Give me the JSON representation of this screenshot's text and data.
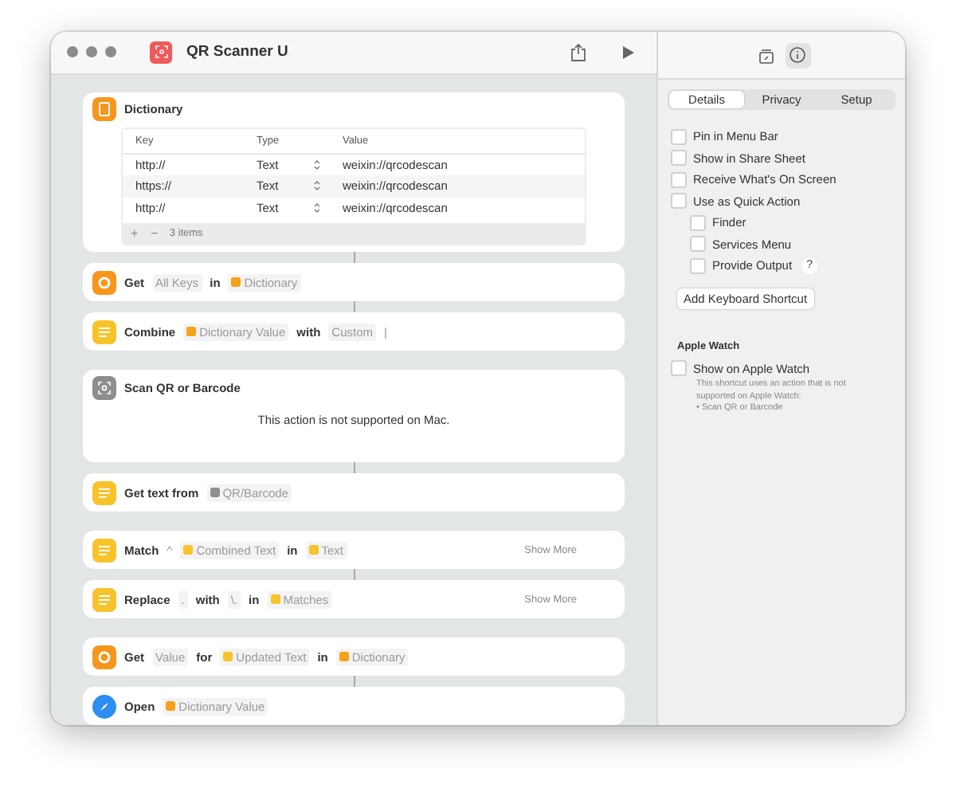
{
  "window": {
    "title": "QR Scanner U"
  },
  "dictionary_action": {
    "title": "Dictionary",
    "columns": [
      "Key",
      "Type",
      "Value"
    ],
    "rows": [
      {
        "key": "http://",
        "type": "Text",
        "value": "weixin://qrcodescan"
      },
      {
        "key": "https://",
        "type": "Text",
        "value": "weixin://qrcodescan"
      },
      {
        "key": "http://",
        "type": "Text",
        "value": "weixin://qrcodescan"
      }
    ],
    "add": "+",
    "remove": "−",
    "count": "3 items"
  },
  "actions": [
    {
      "kind": "value",
      "linked": true,
      "parts": [
        {
          "kind": "word",
          "text": "Get"
        },
        {
          "kind": "token",
          "text": "All Keys"
        },
        {
          "kind": "word",
          "text": "in"
        },
        {
          "kind": "token",
          "text": "Dictionary",
          "color": "#f6a11c"
        }
      ]
    },
    {
      "kind": "text",
      "linked": true,
      "parts": [
        {
          "kind": "word",
          "text": "Combine"
        },
        {
          "kind": "token",
          "text": "Dictionary Value",
          "color": "#f6a11c"
        },
        {
          "kind": "word",
          "text": "with"
        },
        {
          "kind": "token",
          "text": "Custom"
        },
        {
          "kind": "symbol",
          "text": "|"
        }
      ]
    },
    {
      "kind": "scan",
      "linked": false,
      "parts": [
        {
          "kind": "word",
          "text": "Scan QR or Barcode"
        }
      ],
      "message": "This action is not supported on Mac."
    },
    {
      "kind": "text",
      "linked": true,
      "parts": [
        {
          "kind": "word",
          "text": "Get text from"
        },
        {
          "kind": "token",
          "text": "QR/Barcode",
          "color": "#8e8e8e"
        }
      ]
    },
    {
      "kind": "text",
      "linked": false,
      "show_more": "Show More",
      "parts": [
        {
          "kind": "word",
          "text": "Match"
        },
        {
          "kind": "symbol",
          "text": "^"
        },
        {
          "kind": "token",
          "text": "Combined Text",
          "color": "#f8c22a"
        },
        {
          "kind": "word",
          "text": "in"
        },
        {
          "kind": "token",
          "text": "Text",
          "color": "#f8c22a"
        }
      ]
    },
    {
      "kind": "text",
      "linked": true,
      "show_more": "Show More",
      "parts": [
        {
          "kind": "word",
          "text": "Replace"
        },
        {
          "kind": "token",
          "text": "."
        },
        {
          "kind": "word",
          "text": "with"
        },
        {
          "kind": "token",
          "text": "\\."
        },
        {
          "kind": "word",
          "text": "in"
        },
        {
          "kind": "token",
          "text": "Matches",
          "color": "#f8c22a"
        }
      ]
    },
    {
      "kind": "value",
      "linked": false,
      "parts": [
        {
          "kind": "word",
          "text": "Get"
        },
        {
          "kind": "token",
          "text": "Value"
        },
        {
          "kind": "word",
          "text": "for"
        },
        {
          "kind": "token",
          "text": "Updated Text",
          "color": "#f8c22a"
        },
        {
          "kind": "word",
          "text": "in"
        },
        {
          "kind": "token",
          "text": "Dictionary",
          "color": "#f6a11c"
        }
      ]
    },
    {
      "kind": "compass",
      "linked": true,
      "parts": [
        {
          "kind": "word",
          "text": "Open"
        },
        {
          "kind": "token",
          "text": "Dictionary Value",
          "color": "#f6a11c"
        }
      ]
    }
  ],
  "sidebar": {
    "tabs": [
      {
        "label": "Details",
        "selected": true
      },
      {
        "label": "Privacy",
        "selected": false
      },
      {
        "label": "Setup",
        "selected": false
      }
    ],
    "options": [
      {
        "label": "Pin in Menu Bar",
        "checked": false
      },
      {
        "label": "Show in Share Sheet",
        "checked": false
      },
      {
        "label": "Receive What's On Screen",
        "checked": false
      },
      {
        "label": "Use as Quick Action",
        "checked": false,
        "children": [
          {
            "label": "Finder",
            "checked": false
          },
          {
            "label": "Services Menu",
            "checked": false
          },
          {
            "label": "Provide Output",
            "checked": false,
            "help": "?"
          }
        ]
      }
    ],
    "shortcut_button": "Add Keyboard Shortcut",
    "watch": {
      "heading": "Apple Watch",
      "option": {
        "label": "Show on Apple Watch",
        "checked": false
      },
      "note": "This shortcut uses an action that is not supported on Apple Watch:",
      "note_item": "• Scan QR or Barcode"
    }
  }
}
